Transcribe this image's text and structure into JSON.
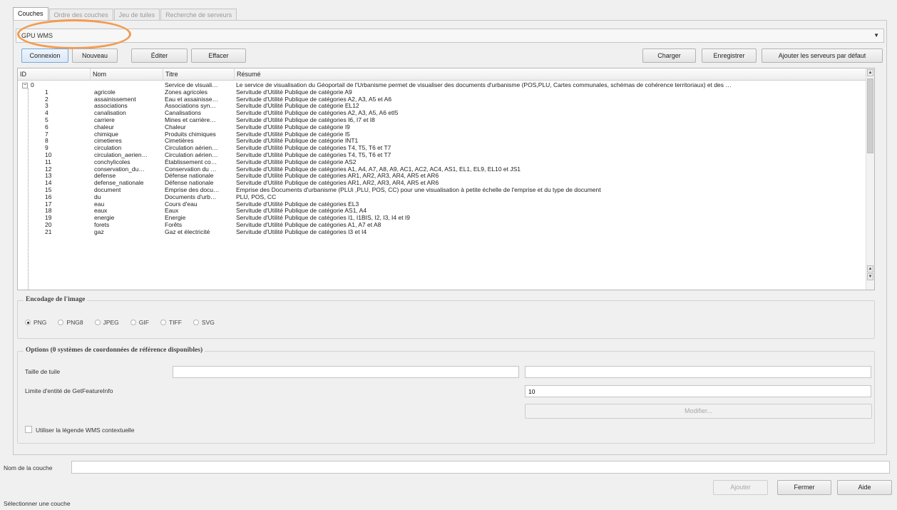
{
  "tabs": [
    {
      "label": "Couches"
    },
    {
      "label": "Ordre des couches"
    },
    {
      "label": "Jeu de tuiles"
    },
    {
      "label": "Recherche de serveurs"
    }
  ],
  "connection": {
    "selected": "GPU WMS"
  },
  "buttons": {
    "connect": "Connexion",
    "new": "Nouveau",
    "edit": "Éditer",
    "delete": "Effacer",
    "load": "Charger",
    "save": "Enregistrer",
    "add_default": "Ajouter les serveurs par défaut"
  },
  "tree": {
    "columns": [
      "ID",
      "Nom",
      "Titre",
      "Résumé"
    ],
    "root": {
      "id": "0",
      "name": "",
      "title": "Service de visuali…",
      "summary": "Le service de visualisation du Géoportail de l'Urbanisme permet de visualiser des documents d'urbanisme (POS,PLU, Cartes communales, schémas de cohérence territoriaux) et des …"
    },
    "rows": [
      {
        "id": "1",
        "name": "agricole",
        "title": "Zones agricoles",
        "summary": "Servitude d'Utilité Publique de catégorie A9"
      },
      {
        "id": "2",
        "name": "assainissement",
        "title": "Eau et assainisse…",
        "summary": "Servitude d'Utilité Publique de catégories A2, A3, A5 et A6"
      },
      {
        "id": "3",
        "name": "associations",
        "title": "Associations syn…",
        "summary": "Servitude d'Utilité Publique de catégorie EL12"
      },
      {
        "id": "4",
        "name": "canalisation",
        "title": "Canalisations",
        "summary": "Servitude d'Utilité Publique de catégories A2, A3, A5, A6 etI5"
      },
      {
        "id": "5",
        "name": "carriere",
        "title": "Mines et carrière…",
        "summary": "Servitude d'Utilité Publique de catégories I6, I7 et I8"
      },
      {
        "id": "6",
        "name": "chaleur",
        "title": "Chaleur",
        "summary": "Servitude d'Utilité Publique de catégorie I9"
      },
      {
        "id": "7",
        "name": "chimique",
        "title": "Produits chimiques",
        "summary": "Servitude d'Utilité Publique de catégorie I5"
      },
      {
        "id": "8",
        "name": "cimetieres",
        "title": "Cimetières",
        "summary": "Servitude d'Utilité Publique de catégorie INT1"
      },
      {
        "id": "9",
        "name": "circulation",
        "title": "Circulation aérien…",
        "summary": "Servitude d'Utilité Publique de catégories T4, T5, T6 et T7"
      },
      {
        "id": "10",
        "name": "circulation_aerien…",
        "title": "Circulation aérien…",
        "summary": "Servitude d'Utilité Publique de catégories T4, T5, T6 et T7"
      },
      {
        "id": "11",
        "name": "conchylicoles",
        "title": "Établissement co…",
        "summary": "Servitude d'Utilité Publique de catégorie AS2"
      },
      {
        "id": "12",
        "name": "conservation_du…",
        "title": "Conservation du …",
        "summary": "Servitude d'Utilité Publique de catégories A1, A4, A7, A8, A9, AC1, AC2, AC4, AS1, EL1, EL9, EL10 et JS1"
      },
      {
        "id": "13",
        "name": "defense",
        "title": "Défense nationale",
        "summary": "Servitude d'Utilité Publique de catégories AR1, AR2, AR3, AR4, AR5 et AR6"
      },
      {
        "id": "14",
        "name": "defense_nationale",
        "title": "Défense nationale",
        "summary": "Servitude d'Utilité Publique de catégories AR1, AR2, AR3, AR4, AR5 et AR6"
      },
      {
        "id": "15",
        "name": "document",
        "title": "Emprise des docu…",
        "summary": "Emprise des Documents d'urbanisme (PLUi ,PLU, POS, CC) pour une visualisation à petite échelle de l'emprise et du type de document"
      },
      {
        "id": "16",
        "name": "du",
        "title": "Documents d'urb…",
        "summary": "PLU, POS, CC"
      },
      {
        "id": "17",
        "name": "eau",
        "title": "Cours d'eau",
        "summary": "Servitude d'Utilité Publique de catégories EL3"
      },
      {
        "id": "18",
        "name": "eaux",
        "title": "Eaux",
        "summary": "Servitude d'Utilité Publique de catégorie AS1, A4"
      },
      {
        "id": "19",
        "name": "energie",
        "title": "Energie",
        "summary": "Servitude d'Utilité Publique de catégories I1, I1BIS, I2, I3, I4 et I9"
      },
      {
        "id": "20",
        "name": "forets",
        "title": "Forêts",
        "summary": "Servitude d'Utilité Publique de catégories A1, A7 et A8"
      },
      {
        "id": "21",
        "name": "gaz",
        "title": "Gaz et électricité",
        "summary": "Servitude d'Utilité Publique de catégories I3 et I4"
      }
    ]
  },
  "encoding": {
    "title": "Encodage de l'image",
    "options": [
      "PNG",
      "PNG8",
      "JPEG",
      "GIF",
      "TIFF",
      "SVG"
    ],
    "selected": "PNG"
  },
  "options_group": {
    "title": "Options (0 systèmes de coordonnées de référence disponibles)",
    "tile_size_label": "Taille de tuile",
    "tile_width": "",
    "tile_height": "",
    "feature_limit_label": "Limite d'entité de GetFeatureInfo",
    "feature_limit_value": "10",
    "modify_button": "Modifier...",
    "contextual_legend_label": "Utiliser la légende WMS contextuelle",
    "contextual_legend_checked": false
  },
  "layer_name": {
    "label": "Nom de la couche",
    "value": ""
  },
  "footer": {
    "add": "Ajouter",
    "close": "Fermer",
    "help": "Aide"
  },
  "status": {
    "text": "Sélectionner une couche"
  },
  "colors": {
    "highlight": "#f29b4f"
  }
}
